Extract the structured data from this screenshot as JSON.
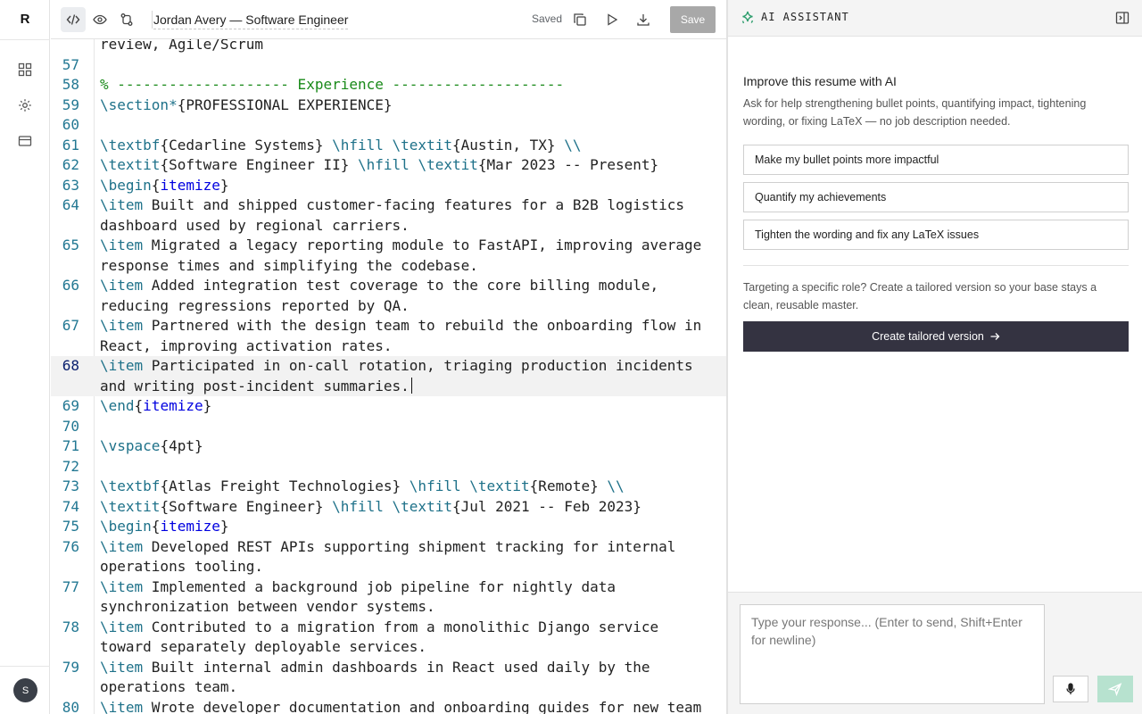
{
  "rail": {
    "logo": "R",
    "avatar_initial": "S",
    "icons": [
      "grid-icon",
      "gear-icon",
      "card-icon"
    ]
  },
  "toolbar": {
    "doc_title": "Jordan Avery — Software Engineer",
    "status": "Saved",
    "save_label": "Save"
  },
  "editor": {
    "current_line": "68",
    "lines": [
      {
        "n": "",
        "t": "review, Agile/Scrum"
      },
      {
        "n": "57",
        "t": ""
      },
      {
        "n": "58",
        "t": "% -------------------- Experience --------------------"
      },
      {
        "n": "59",
        "t": "\\section*{PROFESSIONAL EXPERIENCE}"
      },
      {
        "n": "60",
        "t": ""
      },
      {
        "n": "61",
        "t": "\\textbf{Cedarline Systems} \\hfill \\textit{Austin, TX} \\\\"
      },
      {
        "n": "62",
        "t": "\\textit{Software Engineer II} \\hfill \\textit{Mar 2023 -- Present}"
      },
      {
        "n": "63",
        "t": "\\begin{itemize}"
      },
      {
        "n": "64",
        "t": "\\item Built and shipped customer-facing features for a B2B logistics dashboard used by regional carriers."
      },
      {
        "n": "65",
        "t": "\\item Migrated a legacy reporting module to FastAPI, improving average response times and simplifying the codebase."
      },
      {
        "n": "66",
        "t": "\\item Added integration test coverage to the core billing module, reducing regressions reported by QA."
      },
      {
        "n": "67",
        "t": "\\item Partnered with the design team to rebuild the onboarding flow in React, improving activation rates."
      },
      {
        "n": "68",
        "t": "\\item Participated in on-call rotation, triaging production incidents and writing post-incident summaries."
      },
      {
        "n": "69",
        "t": "\\end{itemize}"
      },
      {
        "n": "70",
        "t": ""
      },
      {
        "n": "71",
        "t": "\\vspace{4pt}"
      },
      {
        "n": "72",
        "t": ""
      },
      {
        "n": "73",
        "t": "\\textbf{Atlas Freight Technologies} \\hfill \\textit{Remote} \\\\"
      },
      {
        "n": "74",
        "t": "\\textit{Software Engineer} \\hfill \\textit{Jul 2021 -- Feb 2023}"
      },
      {
        "n": "75",
        "t": "\\begin{itemize}"
      },
      {
        "n": "76",
        "t": "\\item Developed REST APIs supporting shipment tracking for internal operations tooling."
      },
      {
        "n": "77",
        "t": "\\item Implemented a background job pipeline for nightly data synchronization between vendor systems."
      },
      {
        "n": "78",
        "t": "\\item Contributed to a migration from a monolithic Django service toward separately deployable services."
      },
      {
        "n": "79",
        "t": "\\item Built internal admin dashboards in React used daily by the operations team."
      },
      {
        "n": "80",
        "t": "\\item Wrote developer documentation and onboarding guides for new team"
      }
    ]
  },
  "assistant": {
    "header_title": "AI ASSISTANT",
    "heading": "Improve this resume with AI",
    "subtext": "Ask for help strengthening bullet points, quantifying impact, tightening wording, or fixing LaTeX — no job description needed.",
    "suggestions": [
      "Make my bullet points more impactful",
      "Quantify my achievements",
      "Tighten the wording and fix any LaTeX issues"
    ],
    "targeting_text": "Targeting a specific role? Create a tailored version so your base stays a clean, reusable master.",
    "create_label": "Create tailored version",
    "input_placeholder": "Type your response... (Enter to send, Shift+Enter for newline)"
  },
  "colors": {
    "command": "#1e7189",
    "comment": "#1a8a1a",
    "environment": "#0000e0",
    "line_number": "#237893",
    "dark_button": "#343341",
    "send_button": "#b7e2cf",
    "save_disabled": "#a8a8a8"
  }
}
